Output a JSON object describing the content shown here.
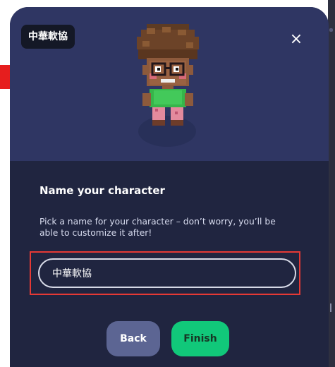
{
  "colors": {
    "modal_top": "#2f3663",
    "modal_bottom": "#202540",
    "highlight": "#e53935",
    "back_button": "#5c6593",
    "finish_button": "#11c87a"
  },
  "character": {
    "name_tag": "中華軟協",
    "avatar_icon": "pixel-character-avatar"
  },
  "dialog": {
    "close_icon": "close-icon",
    "heading": "Name your character",
    "description": "Pick a name for your character – don’t worry, you’ll be able to customize it after!",
    "name_input_value": "中華軟協"
  },
  "buttons": {
    "back": "Back",
    "finish": "Finish"
  }
}
